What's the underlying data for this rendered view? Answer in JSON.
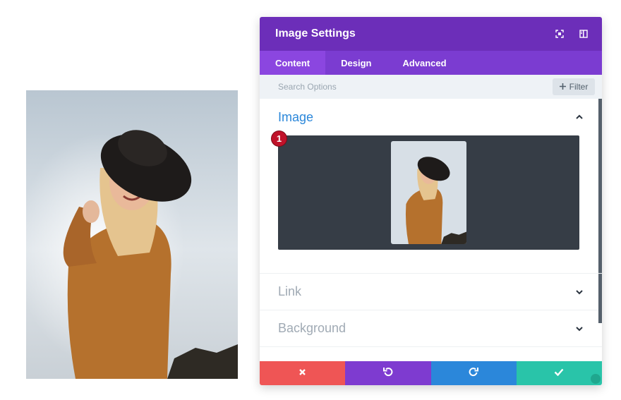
{
  "modal": {
    "title": "Image Settings",
    "header_icons": [
      "expand-icon",
      "sidebar-toggle-icon"
    ],
    "tabs": [
      {
        "label": "Content",
        "active": true
      },
      {
        "label": "Design",
        "active": false
      },
      {
        "label": "Advanced",
        "active": false
      }
    ],
    "search": {
      "placeholder": "Search Options",
      "filter_label": "Filter"
    },
    "sections": {
      "image": {
        "title": "Image",
        "expanded": true,
        "badge": "1"
      },
      "link": {
        "title": "Link",
        "expanded": false
      },
      "background": {
        "title": "Background",
        "expanded": false
      }
    },
    "actions": [
      "discard-icon",
      "undo-icon",
      "redo-icon",
      "save-check-icon"
    ]
  },
  "colors": {
    "header": "#6c2eb9",
    "tabs": "#7b3cd1",
    "tab_active": "#8b46e0",
    "accent_blue": "#2b87da",
    "discard": "#ef5555",
    "undo": "#7e3bd0",
    "redo": "#2b87da",
    "save": "#29c4a9",
    "badge": "#c0122a"
  }
}
